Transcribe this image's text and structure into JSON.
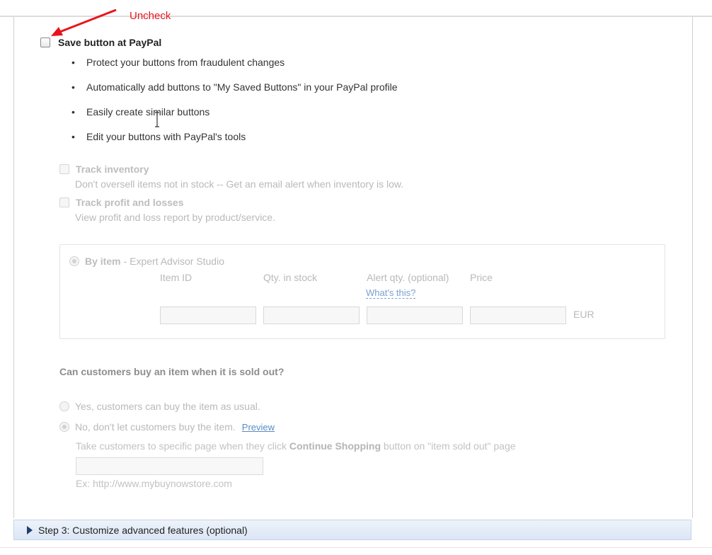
{
  "annotation": {
    "label": "Uncheck",
    "color": "#e8141b"
  },
  "save_option": {
    "label": "Save button at PayPal",
    "checked": false,
    "bullets": [
      "Protect your buttons from fraudulent changes",
      "Automatically add buttons to \"My Saved Buttons\" in your PayPal profile",
      "Easily create similar buttons",
      "Edit your buttons with PayPal's tools"
    ]
  },
  "inventory": {
    "track_inventory": {
      "title": "Track inventory",
      "description": "Don't oversell items not in stock -- Get an email alert when inventory is low."
    },
    "track_profit": {
      "title": "Track profit and losses",
      "description": "View profit and loss report by product/service."
    }
  },
  "by_item": {
    "label": "By item",
    "suffix": "- Expert Advisor Studio",
    "columns": [
      "Item ID",
      "Qty. in stock",
      "Alert qty. (optional)",
      "Price"
    ],
    "whats_this": "What's this?",
    "currency": "EUR"
  },
  "sold_out": {
    "question": "Can customers buy an item when it is sold out?",
    "option_yes": "Yes, customers can buy the item as usual.",
    "option_no": "No, don't let customers buy the item.",
    "preview_link": "Preview",
    "take_prefix": "Take customers to specific page when they click",
    "take_bold": "Continue Shopping",
    "take_suffix": "button on \"item sold out\" page",
    "url_example": "Ex: http://www.mybuynowstore.com"
  },
  "step3": {
    "label": "Step 3: Customize advanced features (optional)"
  }
}
